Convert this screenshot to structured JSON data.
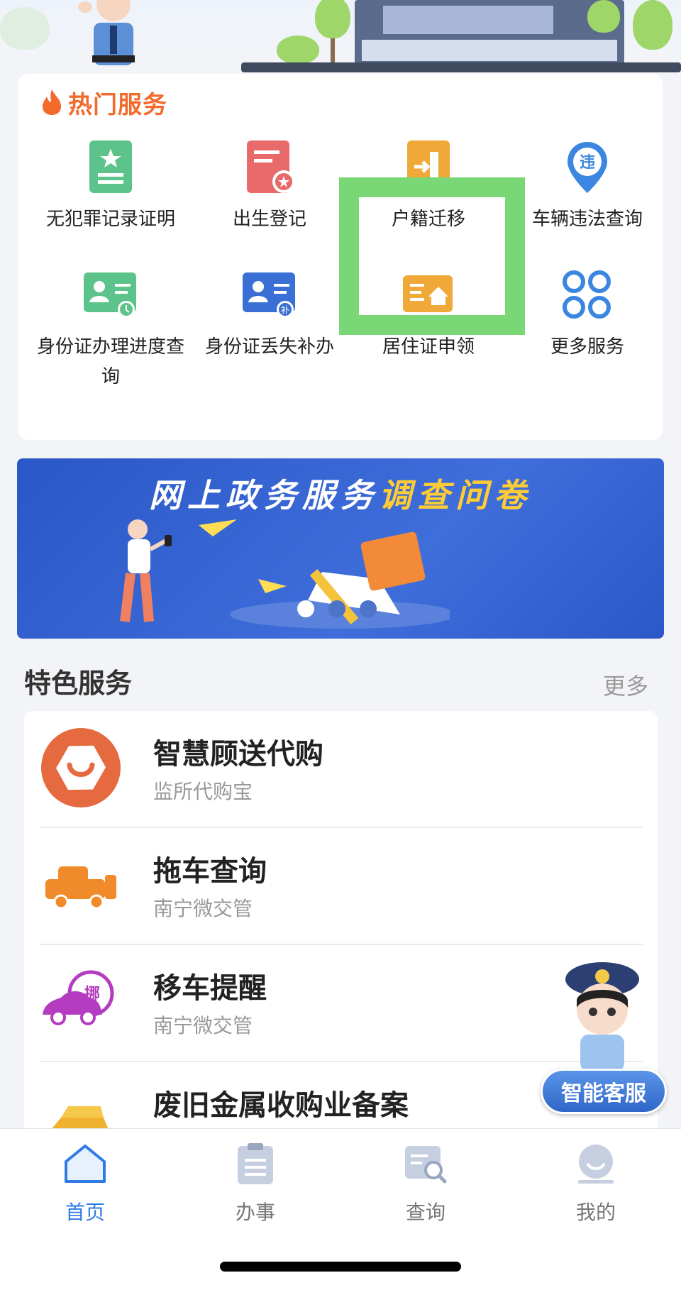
{
  "hot_services": {
    "title": "热门服务",
    "items": [
      {
        "label": "无犯罪记录证明",
        "icon": "certificate-star-icon",
        "color": "#5cc48a"
      },
      {
        "label": "出生登记",
        "icon": "birth-register-icon",
        "color": "#e86a6a"
      },
      {
        "label": "户籍迁移",
        "icon": "household-transfer-icon",
        "color": "#f0a838"
      },
      {
        "label": "车辆违法查询",
        "icon": "violation-pin-icon",
        "color": "#3a86e0"
      },
      {
        "label": "身份证办理进度查询",
        "icon": "id-progress-icon",
        "color": "#5cc48a"
      },
      {
        "label": "身份证丢失补办",
        "icon": "id-reissue-icon",
        "color": "#3a6fd6"
      },
      {
        "label": "居住证申领",
        "icon": "residence-permit-icon",
        "color": "#f0a838"
      },
      {
        "label": "更多服务",
        "icon": "more-grid-icon",
        "color": "#3a86e0"
      }
    ]
  },
  "banner": {
    "title_part1": "网上政务服务",
    "title_part2": "调查问卷",
    "active_slide": 1,
    "slide_count": 3
  },
  "featured": {
    "title": "特色服务",
    "more": "更多",
    "items": [
      {
        "name": "智慧顾送代购",
        "sub": "监所代购宝",
        "icon": "shopping-bag-icon",
        "color": "#e66a40"
      },
      {
        "name": "拖车查询",
        "sub": "南宁微交管",
        "icon": "tow-truck-icon",
        "color": "#f08a2a"
      },
      {
        "name": "移车提醒",
        "sub": "南宁微交管",
        "icon": "move-car-icon",
        "color": "#b43cc0"
      },
      {
        "name": "废旧金属收购业备案",
        "sub": "",
        "icon": "gold-bars-icon",
        "color": "#f0b030"
      }
    ]
  },
  "customer_service": {
    "label": "智能客服"
  },
  "tabbar": {
    "items": [
      {
        "label": "首页",
        "icon": "home-icon",
        "active": true
      },
      {
        "label": "办事",
        "icon": "clipboard-icon",
        "active": false
      },
      {
        "label": "查询",
        "icon": "search-doc-icon",
        "active": false
      },
      {
        "label": "我的",
        "icon": "profile-icon",
        "active": false
      }
    ]
  },
  "colors": {
    "accent": "#2f7be6",
    "hot_title": "#f26a2c",
    "highlight": "#7ad776"
  }
}
